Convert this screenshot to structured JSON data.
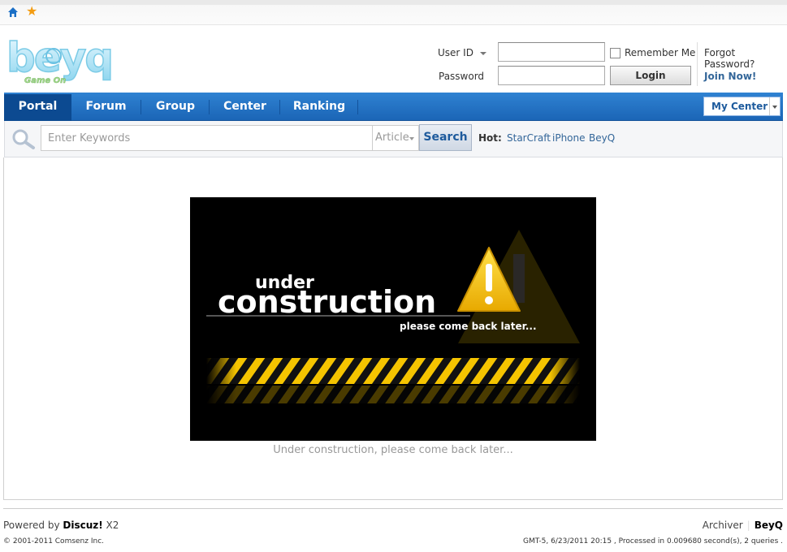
{
  "colors": {
    "nav_bg": "#2172c6",
    "nav_active": "#0c4a91",
    "link": "#336699",
    "warning_yellow": "#f5c400"
  },
  "topbar": {
    "home_icon": "home-icon",
    "favorite_icon": "star-icon"
  },
  "brand": {
    "logo_text": "beyq",
    "logo_tagline": "Game On"
  },
  "login": {
    "userid_label": "User ID",
    "password_label": "Password",
    "remember_label": "Remember Me",
    "login_button": "Login",
    "forgot_link": "Forgot Password?",
    "join_link": "Join Now!"
  },
  "nav": {
    "items": [
      "Portal",
      "Forum",
      "Group",
      "Center",
      "Ranking"
    ],
    "active": "Portal",
    "my_center": "My Center"
  },
  "search": {
    "placeholder": "Enter Keywords",
    "type": "Article",
    "button": "Search",
    "hot_label": "Hot:",
    "hot_links": [
      "StarCraft",
      "iPhone",
      "BeyQ"
    ]
  },
  "main": {
    "banner": {
      "line1": "under",
      "line2": "construction",
      "line3": "please come back later..."
    },
    "caption": "Under construction, please come back later..."
  },
  "footer": {
    "powered_prefix": "Powered by ",
    "powered_brand": "Discuz!",
    "powered_version": " X2",
    "copyright": "© 2001-2011 Comsenz Inc.",
    "archiver": "Archiver",
    "site": "BeyQ",
    "info": "GMT-5, 6/23/2011 20:15 , Processed in 0.009680 second(s), 2 queries ."
  }
}
